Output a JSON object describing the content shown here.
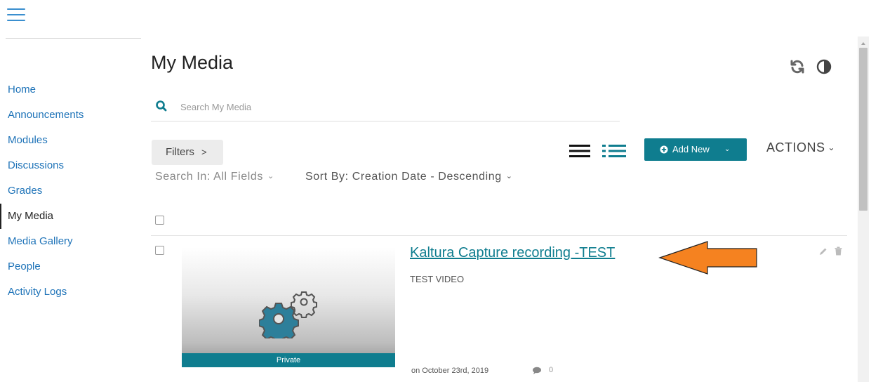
{
  "nav": {
    "items": [
      {
        "label": "Home"
      },
      {
        "label": "Announcements"
      },
      {
        "label": "Modules"
      },
      {
        "label": "Discussions"
      },
      {
        "label": "Grades"
      },
      {
        "label": "My Media",
        "active": true
      },
      {
        "label": "Media Gallery"
      },
      {
        "label": "People"
      },
      {
        "label": "Activity Logs"
      }
    ]
  },
  "page": {
    "title": "My Media"
  },
  "search": {
    "placeholder": "Search My Media"
  },
  "toolbar": {
    "filters_label": "Filters",
    "filters_chevron": ">",
    "add_new_label": "Add New",
    "actions_label": "ACTIONS",
    "search_in_label": "Search In: All Fields",
    "sort_by_label": "Sort By: Creation Date - Descending"
  },
  "entry": {
    "title": "Kaltura Capture recording -TEST",
    "description": "TEST VIDEO",
    "status": "Private",
    "date": "on October 23rd, 2019",
    "comments": "0"
  },
  "colors": {
    "accent": "#0f7d8f",
    "link": "#1e73b8",
    "arrow": "#f58220"
  },
  "icons": [
    "hamburger-icon",
    "refresh-icon",
    "contrast-icon",
    "search-icon",
    "list-view-icon",
    "detailed-view-icon",
    "plus-circle-icon",
    "chevron-down-icon",
    "gears-icon",
    "comment-icon",
    "pencil-icon",
    "trash-icon"
  ]
}
